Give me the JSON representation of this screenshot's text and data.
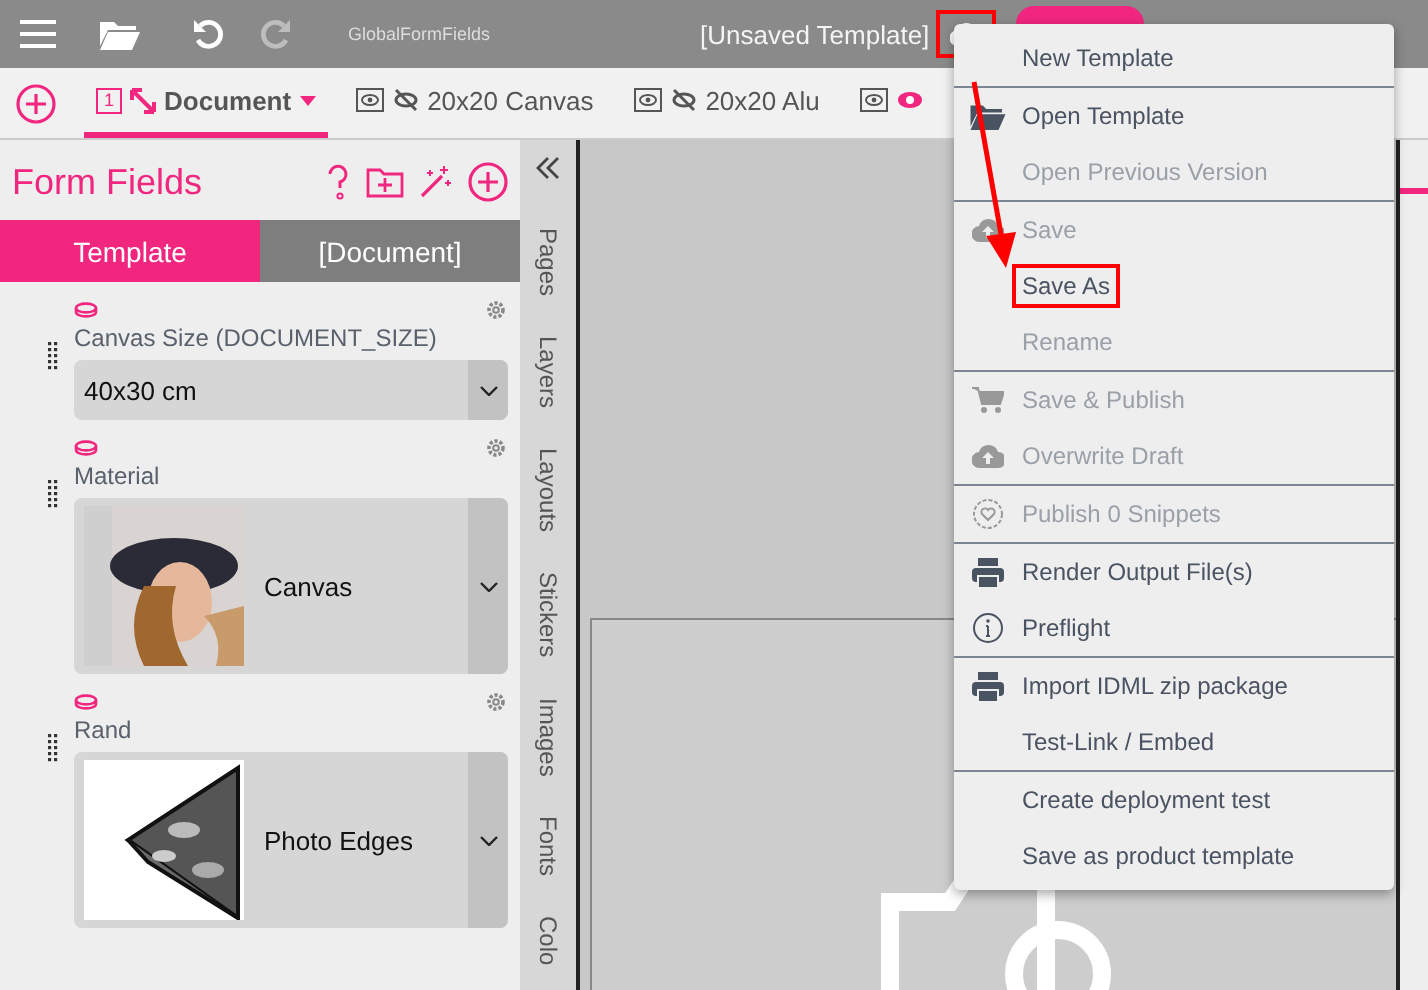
{
  "topbar": {
    "app_name": "GlobalFormFields",
    "title": "[Unsaved Template]",
    "upload_highlighted": true
  },
  "doc_tabs": [
    {
      "label": "Document",
      "number": "1",
      "selected": true,
      "kind": "document"
    },
    {
      "label": "20x20 Canvas",
      "selected": false,
      "kind": "hidden"
    },
    {
      "label": "20x20 Alu",
      "selected": false,
      "kind": "hidden"
    },
    {
      "selected": false,
      "kind": "visible"
    }
  ],
  "panel": {
    "title": "Form Fields",
    "tabs": [
      {
        "label": "Template",
        "selected": true
      },
      {
        "label": "[Document]",
        "selected": false
      }
    ],
    "fields": [
      {
        "label": "Canvas Size (DOCUMENT_SIZE)",
        "kind": "select",
        "value": "40x30 cm"
      },
      {
        "label": "Material",
        "kind": "image-select",
        "value": "Canvas"
      },
      {
        "label": "Rand",
        "kind": "image-select",
        "value": "Photo Edges"
      }
    ]
  },
  "side_tabs": [
    "Pages",
    "Layers",
    "Layouts",
    "Stickers",
    "Images",
    "Fonts",
    "Colo"
  ],
  "menu": [
    [
      {
        "label": "New Template",
        "kind": "plain",
        "disabled": false,
        "highlighted": false
      }
    ],
    [
      {
        "label": "Open Template",
        "kind": "folder",
        "disabled": false,
        "highlighted": false
      },
      {
        "label": "Open Previous Version",
        "kind": "plain",
        "disabled": true,
        "highlighted": false
      }
    ],
    [
      {
        "label": "Save",
        "kind": "cloud",
        "disabled": true,
        "highlighted": false
      },
      {
        "label": "Save As",
        "kind": "plain",
        "disabled": false,
        "highlighted": true
      },
      {
        "label": "Rename",
        "kind": "plain",
        "disabled": true,
        "highlighted": false
      }
    ],
    [
      {
        "label": "Save & Publish",
        "kind": "cart",
        "disabled": true,
        "highlighted": false
      },
      {
        "label": "Overwrite Draft",
        "kind": "cloud",
        "disabled": true,
        "highlighted": false
      }
    ],
    [
      {
        "label": "Publish 0 Snippets",
        "kind": "heart",
        "disabled": true,
        "highlighted": false
      }
    ],
    [
      {
        "label": "Render Output File(s)",
        "kind": "printer",
        "disabled": false,
        "highlighted": false
      },
      {
        "label": "Preflight",
        "kind": "info",
        "disabled": false,
        "highlighted": false
      }
    ],
    [
      {
        "label": "Import IDML zip package",
        "kind": "printer",
        "disabled": false,
        "highlighted": false
      },
      {
        "label": "Test-Link / Embed",
        "kind": "plain",
        "disabled": false,
        "highlighted": false
      }
    ],
    [
      {
        "label": "Create deployment test",
        "kind": "plain",
        "disabled": false,
        "highlighted": false
      },
      {
        "label": "Save as product template",
        "kind": "plain",
        "disabled": false,
        "highlighted": false
      }
    ]
  ]
}
